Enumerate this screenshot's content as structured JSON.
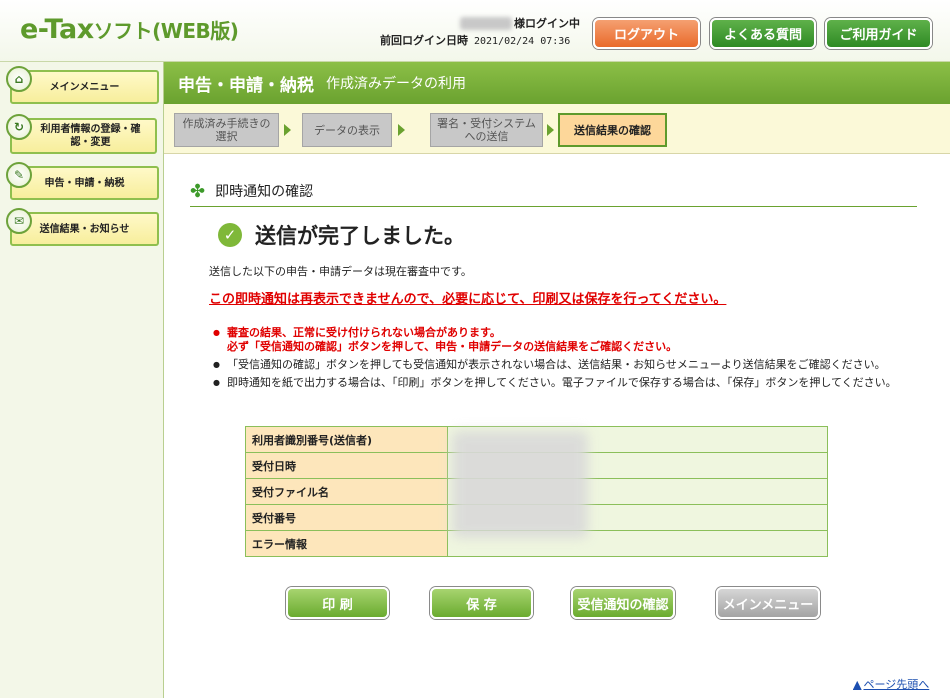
{
  "header": {
    "logo_main": "e-Tax",
    "logo_sub": "ソフト(WEB版)",
    "login_suffix": "様ログイン中",
    "last_login_label": "前回ログイン日時",
    "last_login_value": "2021/02/24 07:36",
    "logout": "ログアウト",
    "faq": "よくある質問",
    "guide": "ご利用ガイド"
  },
  "sidebar": {
    "items": [
      {
        "label": "メインメニュー"
      },
      {
        "label": "利用者情報の登録・確認・変更"
      },
      {
        "label": "申告・申請・納税"
      },
      {
        "label": "送信結果・お知らせ"
      }
    ]
  },
  "titlebar": {
    "title": "申告・申請・納税",
    "subtitle": "作成済みデータの利用"
  },
  "steps": [
    {
      "label": "作成済み手続きの選択"
    },
    {
      "label": "データの表示"
    },
    {
      "label": "署名・受付システムへの送信"
    },
    {
      "label": "送信結果の確認"
    }
  ],
  "content": {
    "section_title": "即時通知の確認",
    "done_message": "送信が完了しました。",
    "msg1": "送信した以下の申告・申請データは現在審査中です。",
    "msg_red": "この即時通知は再表示できませんので、必要に応じて、印刷又は保存を行ってください。",
    "notes": [
      {
        "l1": "審査の結果、正常に受け付けられない場合があります。",
        "l2": "必ず「受信通知の確認」ボタンを押して、申告・申請データの送信結果をご確認ください。"
      },
      {
        "l1": "「受信通知の確認」ボタンを押しても受信通知が表示されない場合は、送信結果・お知らせメニューより送信結果をご確認ください。"
      },
      {
        "l1": "即時通知を紙で出力する場合は、「印刷」ボタンを押してください。電子ファイルで保存する場合は、「保存」ボタンを押してください。"
      }
    ],
    "table": [
      {
        "key": "利用者識別番号(送信者)"
      },
      {
        "key": "受付日時"
      },
      {
        "key": "受付ファイル名"
      },
      {
        "key": "受付番号"
      },
      {
        "key": "エラー情報"
      }
    ]
  },
  "buttons": {
    "print": "印 刷",
    "save": "保 存",
    "receipt": "受信通知の確認",
    "main_menu": "メインメニュー"
  },
  "footer": {
    "page_top": "ページ先頭へ"
  },
  "colors": {
    "brand_green": "#6aa22f",
    "logout_orange": "#e96a2b",
    "alert_red": "#e00000"
  }
}
